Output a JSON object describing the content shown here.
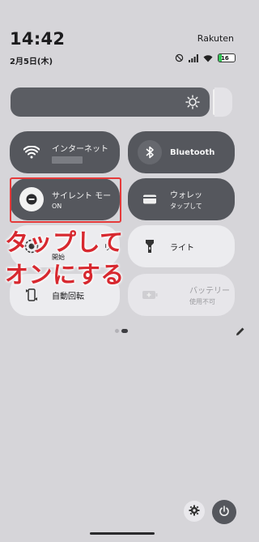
{
  "status_bar": {
    "time": "14:42",
    "carrier": "Rakuten",
    "date": "2月5日(木)",
    "battery_level": "16",
    "icons": [
      "dnd-icon",
      "signal-icon",
      "wifi-icon",
      "battery-icon"
    ]
  },
  "brightness": {
    "icon": "sun-icon",
    "level": 0.95
  },
  "tiles": [
    {
      "name": "internet",
      "label": "インターネット",
      "sublabel": "",
      "state": "on",
      "icon": "wifi-icon"
    },
    {
      "name": "bluetooth",
      "label": "Bluetooth",
      "sublabel": "",
      "state": "on",
      "icon": "bluetooth-icon"
    },
    {
      "name": "silent-mode",
      "label": "サイレント モー",
      "sublabel": "ON",
      "state": "on",
      "icon": "minus-circle-icon"
    },
    {
      "name": "wallet",
      "label": "ウォレッ",
      "sublabel": "タップして",
      "state": "on",
      "icon": "wallet-icon"
    },
    {
      "name": "screen-record",
      "label": "リ",
      "sublabel": "開始",
      "state": "off",
      "icon": "record-icon"
    },
    {
      "name": "flashlight",
      "label": "ライト",
      "sublabel": "",
      "state": "off",
      "icon": "flashlight-icon"
    },
    {
      "name": "auto-rotate",
      "label": "自動回転",
      "sublabel": "",
      "state": "off",
      "icon": "rotate-icon"
    },
    {
      "name": "battery-saver",
      "label": "バッテリー",
      "sublabel": "使用不可",
      "state": "unavailable",
      "icon": "battery-plus-icon"
    }
  ],
  "annotation": {
    "line1": "タップして",
    "line2": "オンにする",
    "color": "#d7282f",
    "box_color": "#e53a3a"
  },
  "pager": {
    "pages": 2,
    "current": 1
  },
  "footer": {
    "settings_icon": "gear-icon",
    "power_icon": "power-icon",
    "edit_icon": "pencil-icon"
  }
}
